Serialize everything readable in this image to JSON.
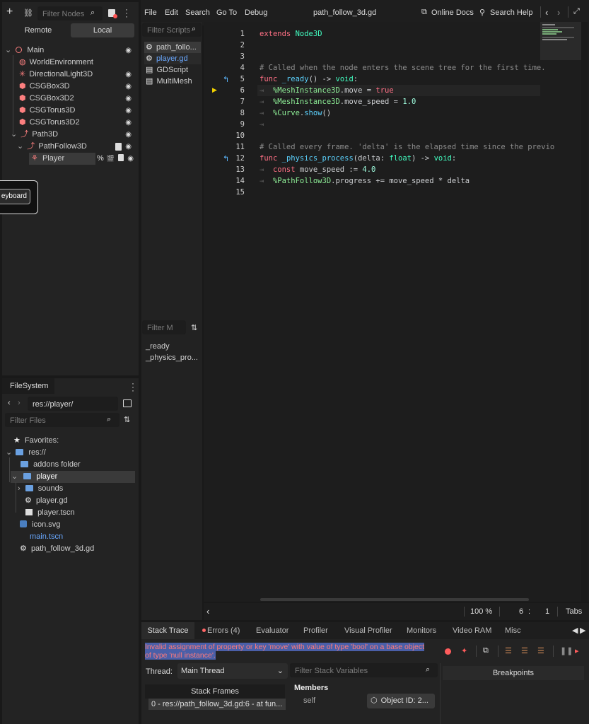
{
  "scene": {
    "filter_placeholder": "Filter Nodes",
    "remote_label": "Remote",
    "local_label": "Local",
    "nodes": [
      {
        "name": "Main",
        "icon": "node3d-circle-icon"
      },
      {
        "name": "WorldEnvironment",
        "icon": "world-environment-icon"
      },
      {
        "name": "DirectionalLight3D",
        "icon": "directional-light-icon"
      },
      {
        "name": "CSGBox3D",
        "icon": "csg-box-icon"
      },
      {
        "name": "CSGBox3D2",
        "icon": "csg-box-icon"
      },
      {
        "name": "CSGTorus3D",
        "icon": "csg-torus-icon"
      },
      {
        "name": "CSGTorus3D2",
        "icon": "csg-torus-icon"
      },
      {
        "name": "Path3D",
        "icon": "path3d-icon"
      },
      {
        "name": "PathFollow3D",
        "icon": "pathfollow3d-icon"
      },
      {
        "name": "Player",
        "icon": "character-body-icon"
      }
    ],
    "tooltip": "eyboard",
    "player_badge": "%"
  },
  "filesystem": {
    "tab_label": "FileSystem",
    "path": "res://player/",
    "filter_placeholder": "Filter Files",
    "items": [
      {
        "label": "Favorites:",
        "icon": "star-icon"
      },
      {
        "label": "res://",
        "icon": "folder-icon"
      },
      {
        "label": "addons folder",
        "icon": "folder-icon"
      },
      {
        "label": "player",
        "icon": "folder-icon"
      },
      {
        "label": "sounds",
        "icon": "folder-icon"
      },
      {
        "label": "player.gd",
        "icon": "gear-icon"
      },
      {
        "label": "player.tscn",
        "icon": "clapperboard-icon"
      },
      {
        "label": "icon.svg",
        "icon": "image-icon"
      },
      {
        "label": "main.tscn",
        "icon": "none"
      },
      {
        "label": "path_follow_3d.gd",
        "icon": "gear-icon"
      }
    ]
  },
  "menu": {
    "items": [
      "File",
      "Edit",
      "Search",
      "Go To",
      "Debug"
    ],
    "file_title": "path_follow_3d.gd",
    "online_docs": "Online Docs",
    "search_help": "Search Help"
  },
  "scripts": {
    "filter_placeholder": "Filter Scripts",
    "list": [
      "path_follo...",
      "player.gd",
      "GDScript",
      "MultiMesh"
    ],
    "methods_filter_placeholder": "Filter M",
    "methods": [
      "_ready",
      "_physics_pro..."
    ]
  },
  "code": {
    "line_numbers": [
      "1",
      "2",
      "3",
      "4",
      "5",
      "6",
      "7",
      "8",
      "9",
      "10",
      "11",
      "12",
      "13",
      "14",
      "15"
    ],
    "l1": {
      "kw": "extends",
      "rest": "Node3D"
    },
    "l4": "# Called when the node enters the scene tree for the first time.",
    "l5": {
      "kw": "func",
      "fn": "_ready",
      "rest": "() -> ",
      "ty": "void",
      ":": ":"
    },
    "l6": {
      "nd": "%MeshInstance3D",
      "rest": ".move = ",
      "kw": "true"
    },
    "l7": {
      "nd": "%MeshInstance3D",
      "rest": ".move_speed = ",
      "num": "1.0"
    },
    "l8": {
      "nd": "%Curve",
      "rest": ".",
      "fn": "show",
      "end": "()"
    },
    "l11": "# Called every frame. 'delta' is the elapsed time since the previo",
    "l12": {
      "kw": "func",
      "fn": "_physics_process",
      "a": "(delta: ",
      "ty": "float",
      "b": ") -> ",
      "ty2": "void",
      "end": ":"
    },
    "l13": {
      "kw": "const",
      "rest": " move_speed := ",
      "num": "4.0"
    },
    "l14": {
      "nd": "%PathFollow3D",
      "rest": ".progress += move_speed * delta"
    },
    "zoom": "100 %",
    "cursor_line": "6",
    "cursor_col": "1",
    "indent": "Tabs"
  },
  "debugger": {
    "tabs": [
      "Stack Trace",
      "Errors (4)",
      "Evaluator",
      "Profiler",
      "Visual Profiler",
      "Monitors",
      "Video RAM",
      "Misc"
    ],
    "error": "Invalid assignment of property or key 'move' with value of type 'bool' on a base object of type 'null instance'.",
    "thread_label": "Thread:",
    "thread_value": "Main Thread",
    "stack_vars_placeholder": "Filter Stack Variables",
    "breakpoints_label": "Breakpoints",
    "stack_frames_label": "Stack Frames",
    "frame0": "0 - res://path_follow_3d.gd:6 - at fun...",
    "members_label": "Members",
    "self_label": "self",
    "object_id": "Object ID: 2..."
  }
}
